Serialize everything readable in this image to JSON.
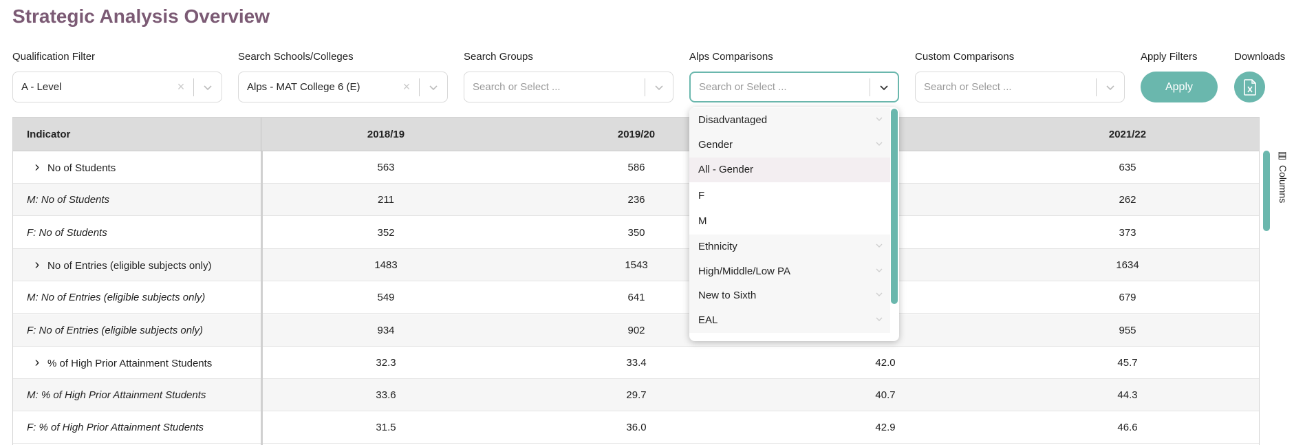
{
  "page_title": "Strategic Analysis Overview",
  "filters": {
    "qualification": {
      "label": "Qualification Filter",
      "value": "A - Level"
    },
    "schools": {
      "label": "Search Schools/Colleges",
      "value": "Alps - MAT College 6 (E)"
    },
    "groups": {
      "label": "Search Groups",
      "placeholder": "Search or Select ..."
    },
    "alps": {
      "label": "Alps Comparisons",
      "placeholder": "Search or Select ..."
    },
    "custom": {
      "label": "Custom Comparisons",
      "placeholder": "Search or Select ..."
    },
    "apply": {
      "label": "Apply Filters",
      "button": "Apply"
    },
    "downloads": {
      "label": "Downloads",
      "icon": "excel-file-icon"
    }
  },
  "colors": {
    "accent": "#6ab7ad",
    "title": "#7b5a74"
  },
  "table": {
    "headers": [
      "Indicator",
      "2018/19",
      "2019/20",
      "",
      "2021/22"
    ],
    "rows": [
      {
        "indicator": "No of Students",
        "expandable": true,
        "values": [
          "563",
          "586",
          "",
          "635"
        ]
      },
      {
        "indicator": "M: No of Students",
        "values": [
          "211",
          "236",
          "",
          "262"
        ]
      },
      {
        "indicator": "F: No of Students",
        "values": [
          "352",
          "350",
          "",
          "373"
        ]
      },
      {
        "indicator": "No of Entries (eligible subjects only)",
        "expandable": true,
        "values": [
          "1483",
          "1543",
          "",
          "1634"
        ]
      },
      {
        "indicator": "M: No of Entries (eligible subjects only)",
        "values": [
          "549",
          "641",
          "",
          "679"
        ]
      },
      {
        "indicator": "F: No of Entries (eligible subjects only)",
        "values": [
          "934",
          "902",
          "",
          "955"
        ]
      },
      {
        "indicator": "% of High Prior Attainment Students",
        "expandable": true,
        "values": [
          "32.3",
          "33.4",
          "42.0",
          "45.7"
        ]
      },
      {
        "indicator": "M: % of High Prior Attainment Students",
        "values": [
          "33.6",
          "29.7",
          "40.7",
          "44.3"
        ]
      },
      {
        "indicator": "F: % of High Prior Attainment Students",
        "values": [
          "31.5",
          "36.0",
          "42.9",
          "46.6"
        ]
      }
    ]
  },
  "columns_tab": "Columns",
  "dropdown": {
    "items": [
      {
        "label": "Disadvantaged",
        "type": "group"
      },
      {
        "label": "Gender",
        "type": "group"
      },
      {
        "label": "All - Gender",
        "type": "option",
        "state": "hover"
      },
      {
        "label": "F",
        "type": "option"
      },
      {
        "label": "M",
        "type": "option"
      },
      {
        "label": "Ethnicity",
        "type": "group"
      },
      {
        "label": "High/Middle/Low PA",
        "type": "group"
      },
      {
        "label": "New to Sixth",
        "type": "group"
      },
      {
        "label": "EAL",
        "type": "group"
      }
    ]
  }
}
